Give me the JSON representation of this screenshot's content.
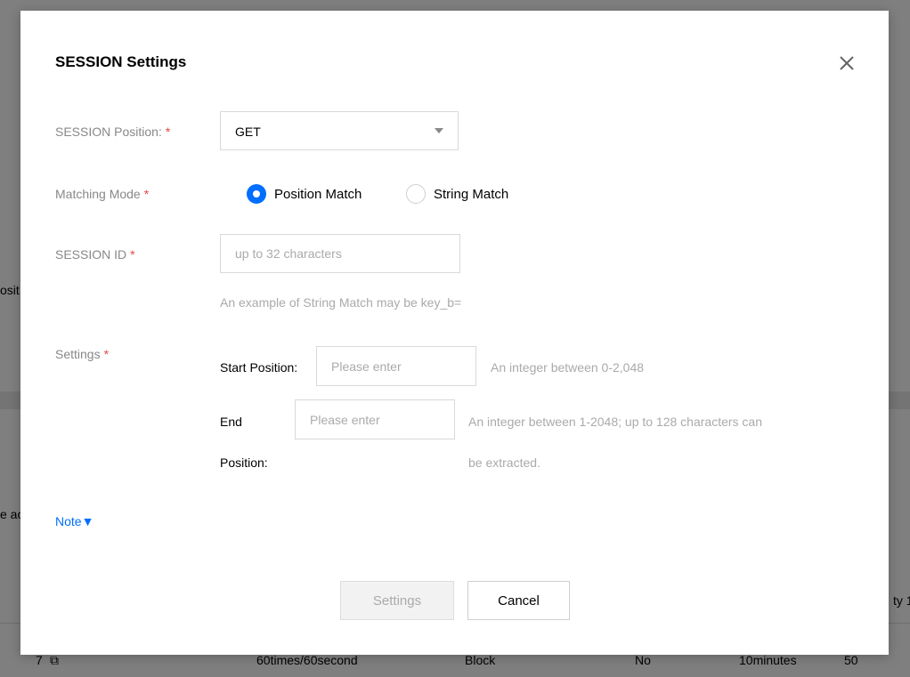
{
  "background": {
    "left_fragment_1": "osit",
    "left_fragment_2": "e ac",
    "right_fragment": "ty 1",
    "table_row": {
      "index": "7",
      "rate": "60times/60second",
      "action": "Block",
      "flag": "No",
      "duration": "10minutes",
      "priority": "50"
    }
  },
  "modal": {
    "title": "SESSION Settings",
    "close_icon": "close-icon",
    "fields": {
      "session_position": {
        "label": "SESSION Position:",
        "required_mark": "*",
        "selected": "GET"
      },
      "matching_mode": {
        "label": "Matching Mode",
        "required_mark": "*",
        "options": [
          {
            "label": "Position Match",
            "checked": true
          },
          {
            "label": "String Match",
            "checked": false
          }
        ]
      },
      "session_id": {
        "label": "SESSION ID",
        "required_mark": "*",
        "placeholder": "up to 32 characters",
        "hint": "An example of String Match may be key_b="
      },
      "settings": {
        "label": "Settings",
        "required_mark": "*",
        "start_position": {
          "label": "Start Position:",
          "placeholder": "Please enter",
          "hint": "An integer between 0-2,048"
        },
        "end_position": {
          "label_line1": "End",
          "label_line2": "Position:",
          "placeholder": "Please enter",
          "hint_line1": "An integer between 1-2048; up to 128 characters can",
          "hint_line2": "be extracted."
        }
      }
    },
    "note_link": "Note▼",
    "buttons": {
      "settings": "Settings",
      "cancel": "Cancel"
    }
  },
  "colors": {
    "accent": "#006eff",
    "required": "#e54545"
  }
}
